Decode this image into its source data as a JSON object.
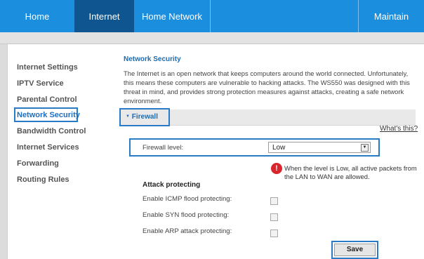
{
  "nav": {
    "home": "Home",
    "internet": "Internet",
    "home_network": "Home Network",
    "maintain": "Maintain"
  },
  "sidebar": {
    "items": [
      {
        "label": "Internet Settings"
      },
      {
        "label": "IPTV Service"
      },
      {
        "label": "Parental Control"
      },
      {
        "label": "Network Security"
      },
      {
        "label": "Bandwidth Control"
      },
      {
        "label": "Internet Services"
      },
      {
        "label": "Forwarding"
      },
      {
        "label": "Routing Rules"
      }
    ],
    "active_index": 3
  },
  "main": {
    "title": "Network Security",
    "description": "The Internet is an open network that keeps computers around the world connected. Unfortunately, this means these computers are vulnerable to hacking attacks. The WS550 was designed with this threat in mind, and provides strong protection measures against attacks, creating a safe network environment.",
    "firewall_section": "Firewall",
    "firewall_arrow": "▼",
    "whats_this": "What's this?",
    "firewall_level_label": "Firewall level:",
    "firewall_level_value": "Low",
    "select_arrow": "▼",
    "alert_mark": "!",
    "level_note": "When the level is Low, all active packets from the LAN to WAN are allowed.",
    "attack_heading": "Attack protecting",
    "options": [
      {
        "label": "Enable ICMP flood protecting:",
        "checked": false
      },
      {
        "label": "Enable SYN flood protecting:",
        "checked": false
      },
      {
        "label": "Enable ARP attack protecting:",
        "checked": false
      }
    ],
    "save_label": "Save"
  },
  "colors": {
    "nav_bg": "#1c8ede",
    "nav_active": "#0f5590",
    "highlight": "#2a7bc6",
    "title_blue": "#1a6db5",
    "alert_red": "#d8262c"
  }
}
